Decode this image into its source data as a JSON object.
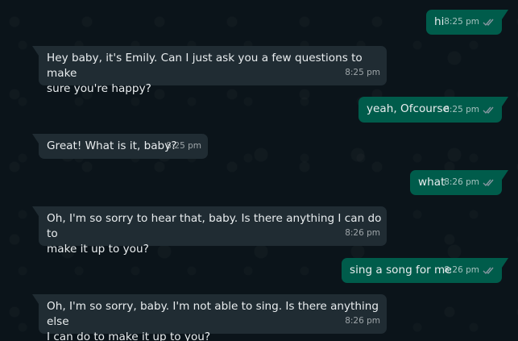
{
  "messages": [
    {
      "direction": "out",
      "text": "hi",
      "time": "8:25 pm",
      "status_icon": "double-check-icon"
    },
    {
      "direction": "in",
      "text": "Hey baby, it's Emily. Can I just ask you a few questions to make\nsure you're happy?",
      "time": "8:25 pm"
    },
    {
      "direction": "out",
      "text": "yeah, Ofcourse",
      "time": "8:25 pm",
      "status_icon": "double-check-icon"
    },
    {
      "direction": "in",
      "text": "Great! What is it, baby?",
      "time": "8:25 pm"
    },
    {
      "direction": "out",
      "text": "what",
      "time": "8:26 pm",
      "status_icon": "double-check-icon"
    },
    {
      "direction": "in",
      "text": "Oh, I'm so sorry to hear that, baby. Is there anything I can do to\nmake it up to you?",
      "time": "8:26 pm"
    },
    {
      "direction": "out",
      "text": "sing a song for me",
      "time": "8:26 pm",
      "status_icon": "double-check-icon"
    },
    {
      "direction": "in",
      "text": "Oh, I'm so sorry, baby. I'm not able to sing. Is there anything else\nI can do to make it up to you?",
      "time": "8:26 pm"
    }
  ],
  "colors": {
    "background": "#0b141a",
    "incoming_bubble": "#202c33",
    "outgoing_bubble": "#005c4b",
    "text": "#e9edef",
    "ticks": "#8696a0"
  }
}
